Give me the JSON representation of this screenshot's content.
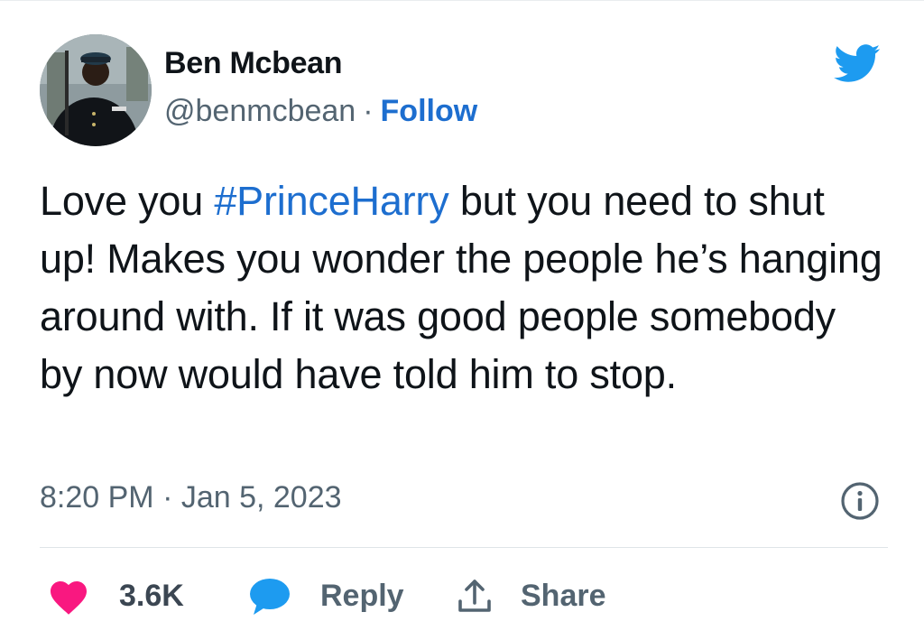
{
  "author": {
    "name": "Ben Mcbean",
    "handle": "@benmcbean",
    "separator": "·",
    "follow_label": "Follow"
  },
  "tweet": {
    "text_before": "Love you ",
    "hashtag": "#PrinceHarry",
    "text_after": " but you need to shut up! Makes you wonder the people he’s hanging around with. If it was good people somebody by now would have told him to stop."
  },
  "meta": {
    "timestamp": "8:20 PM · Jan 5, 2023"
  },
  "actions": {
    "like_count": "3.6K",
    "reply_label": "Reply",
    "share_label": "Share"
  },
  "icons": {
    "brand": "twitter-bird-icon",
    "info": "info-icon",
    "like": "heart-icon",
    "reply": "speech-bubble-icon",
    "share": "share-arrow-icon"
  },
  "colors": {
    "brand_blue": "#1d9bf0",
    "link_blue": "#1d6ecf",
    "like_pink": "#f91880",
    "text_primary": "#0f1419",
    "text_secondary": "#536471"
  }
}
